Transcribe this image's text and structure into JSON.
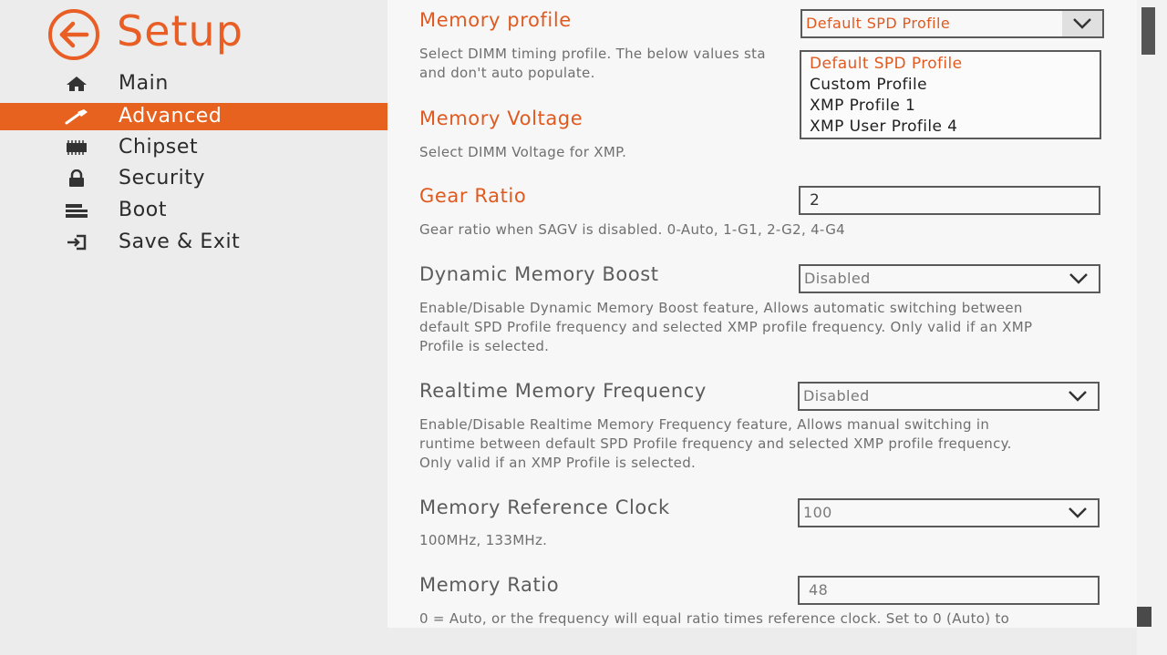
{
  "header": {
    "title": "Setup"
  },
  "sidebar": {
    "items": [
      {
        "label": "Main",
        "icon": "home-icon"
      },
      {
        "label": "Advanced",
        "icon": "wrench-icon",
        "active": true
      },
      {
        "label": "Chipset",
        "icon": "chip-icon"
      },
      {
        "label": "Security",
        "icon": "lock-icon"
      },
      {
        "label": "Boot",
        "icon": "drive-icon"
      },
      {
        "label": "Save & Exit",
        "icon": "exit-icon"
      }
    ]
  },
  "colors": {
    "accent": "#e8621f",
    "title_orange": "#e05a20"
  },
  "settings": {
    "memory_profile": {
      "title": "Memory profile",
      "desc_line1": "Select DIMM timing profile. The below values sta",
      "desc_line2": "and don't auto populate.",
      "value": "Default SPD Profile",
      "options": [
        "Default SPD Profile",
        "Custom Profile",
        "XMP Profile 1",
        "XMP User Profile 4"
      ]
    },
    "memory_voltage": {
      "title": "Memory Voltage",
      "desc": "Select DIMM Voltage for XMP."
    },
    "gear_ratio": {
      "title": "Gear Ratio",
      "desc": "Gear ratio when SAGV is disabled. 0-Auto, 1-G1, 2-G2, 4-G4",
      "value": "2"
    },
    "dynamic_memory_boost": {
      "title": "Dynamic Memory Boost",
      "desc_line1": "Enable/Disable Dynamic Memory Boost feature, Allows automatic switching between",
      "desc_line2": "default SPD Profile frequency and selected XMP profile frequency. Only valid if an XMP",
      "desc_line3": "Profile is selected.",
      "value": "Disabled"
    },
    "realtime_memory_frequency": {
      "title": "Realtime Memory Frequency",
      "desc_line1": "Enable/Disable Realtime Memory Frequency feature, Allows manual switching in",
      "desc_line2": "runtime between default SPD Profile frequency and selected XMP profile frequency.",
      "desc_line3": "Only valid if an XMP Profile is selected.",
      "value": "Disabled"
    },
    "memory_reference_clock": {
      "title": "Memory Reference Clock",
      "desc": "100MHz, 133MHz.",
      "value": "100"
    },
    "memory_ratio": {
      "title": "Memory Ratio",
      "desc": "0 = Auto, or the frequency will equal ratio times reference clock. Set to 0 (Auto) to",
      "value": "48"
    }
  }
}
